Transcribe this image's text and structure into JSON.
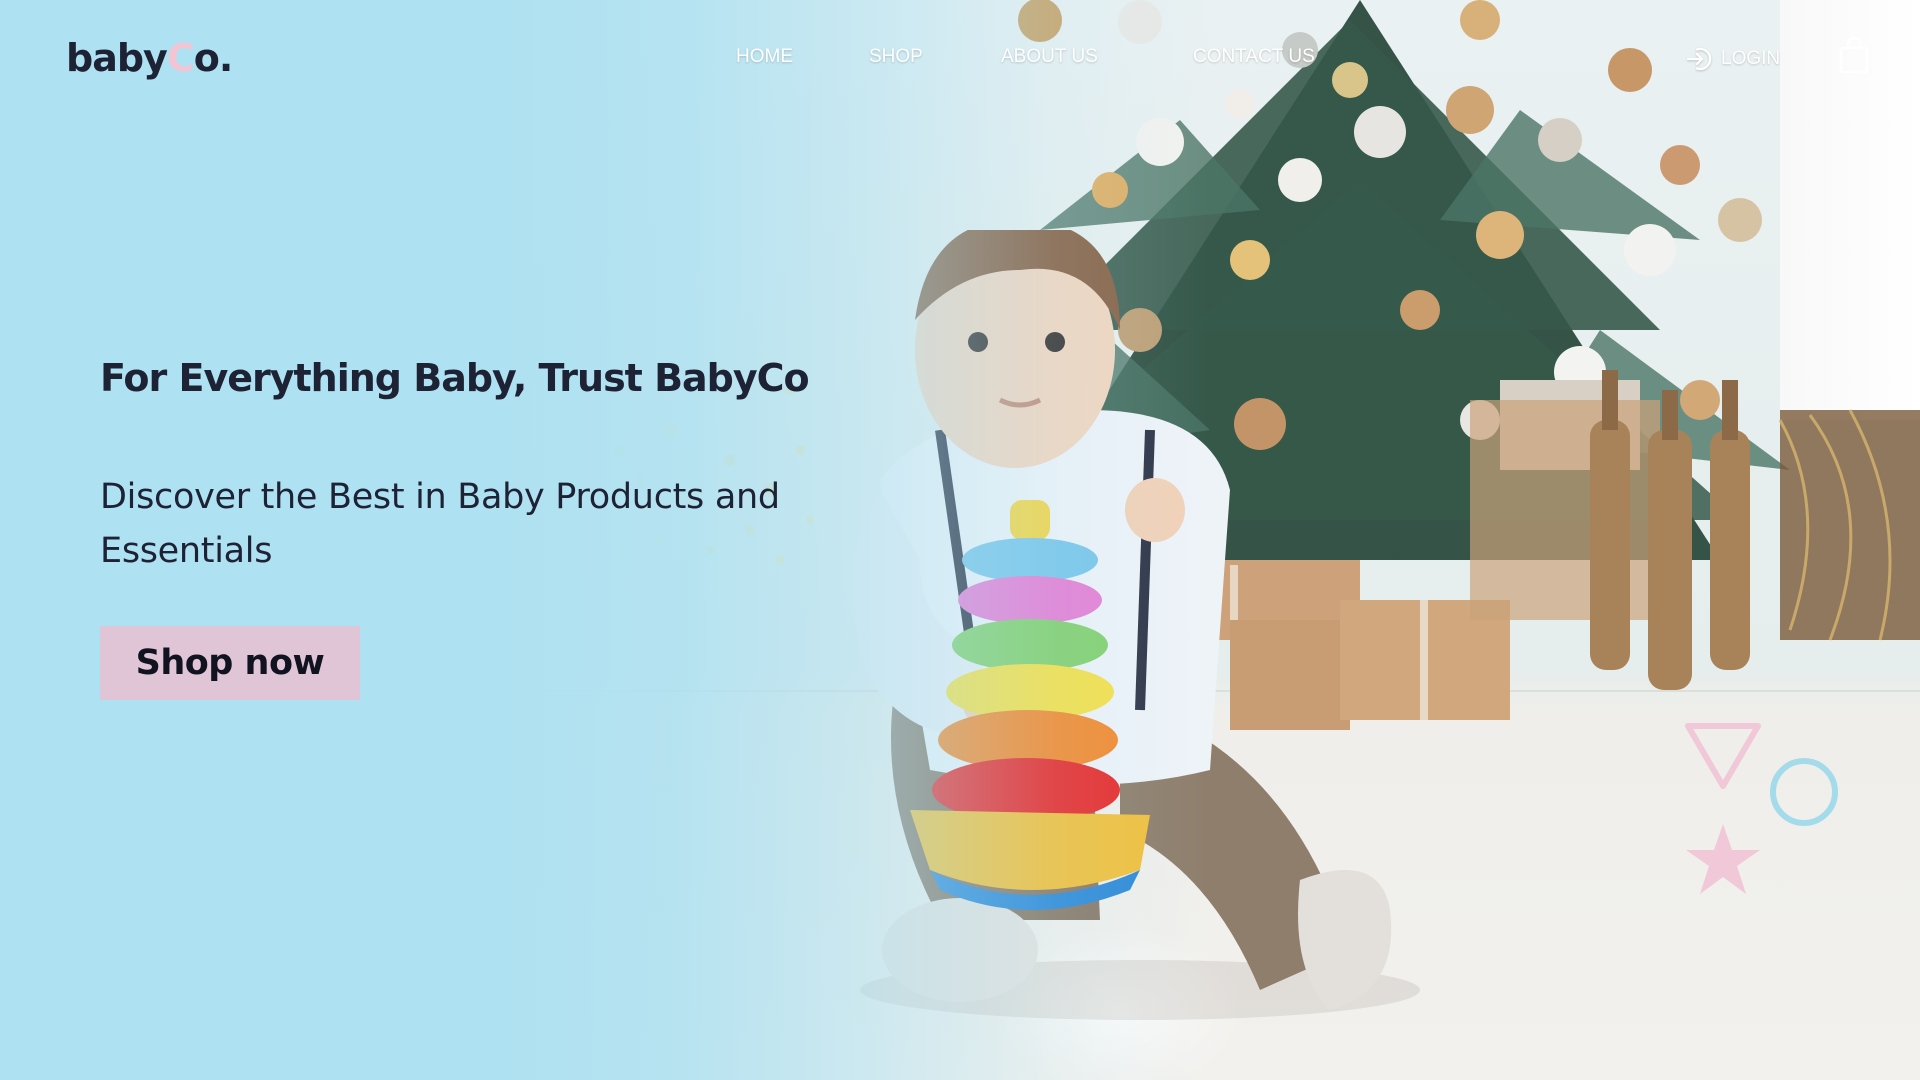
{
  "header": {
    "logo": {
      "part1": "baby",
      "part2": "C",
      "part3": "o."
    },
    "nav": [
      {
        "label": "HOME"
      },
      {
        "label": "SHOP"
      },
      {
        "label": "ABOUT US"
      },
      {
        "label": "CONTACT US"
      }
    ],
    "login_label": "LOGIN"
  },
  "hero": {
    "title": "For Everything Baby, Trust BabyCo",
    "subtitle": "Discover the Best in Baby Products and Essentials",
    "cta_label": "Shop now"
  },
  "colors": {
    "background": "#b3e3f1",
    "text": "#1e2235",
    "accent_pink": "#f2c5d4",
    "cta_bg": "#dfc5d6"
  },
  "icons": [
    "login-icon",
    "shopping-bag-icon",
    "triangle-icon",
    "circle-icon",
    "star-icon"
  ]
}
